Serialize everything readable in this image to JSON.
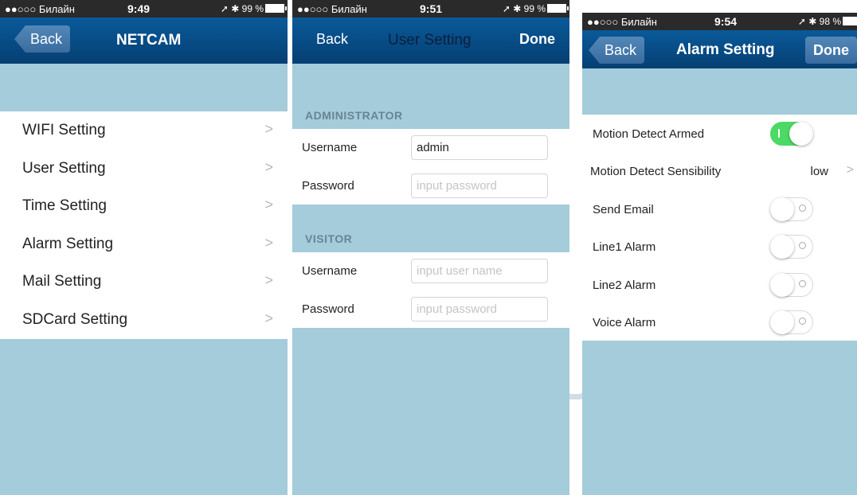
{
  "status_bar": {
    "carrier": "●●○○○ Билайн",
    "screen1": {
      "time": "9:49",
      "battery": "99 %"
    },
    "screen2": {
      "time": "9:51",
      "battery": "99 %"
    },
    "screen3": {
      "time": "9:54",
      "battery": "98 %"
    }
  },
  "screen1": {
    "back_label": "Back",
    "title": "NETCAM",
    "items": [
      {
        "label": "WIFI Setting"
      },
      {
        "label": "User Setting"
      },
      {
        "label": "Time Setting"
      },
      {
        "label": "Alarm Setting"
      },
      {
        "label": "Mail Setting"
      },
      {
        "label": "SDCard Setting"
      }
    ],
    "chevron": ">"
  },
  "screen2": {
    "back_label": "Back",
    "title": "User Setting",
    "done_label": "Done",
    "administrator": {
      "header": "ADMINISTRATOR",
      "username_label": "Username",
      "username_value": "admin",
      "password_label": "Password",
      "password_placeholder": "input password"
    },
    "visitor": {
      "header": "VISITOR",
      "username_label": "Username",
      "username_placeholder": "input user name",
      "password_label": "Password",
      "password_placeholder": "input password"
    }
  },
  "screen3": {
    "back_label": "Back",
    "title": "Alarm Setting",
    "done_label": "Done",
    "rows": [
      {
        "label": "Motion Detect Armed",
        "toggle_on": true
      },
      {
        "label": "Motion Detect Sensibility",
        "value": "low"
      },
      {
        "label": "Send Email",
        "toggle_on": false
      },
      {
        "label": "Line1 Alarm",
        "toggle_on": false
      },
      {
        "label": "Line2 Alarm",
        "toggle_on": false
      },
      {
        "label": "Voice Alarm",
        "toggle_on": false
      }
    ],
    "chevron": ">"
  },
  "colors": {
    "navbar": "#053f72",
    "background": "#a4ccda",
    "toggle_on": "#4cd964"
  }
}
